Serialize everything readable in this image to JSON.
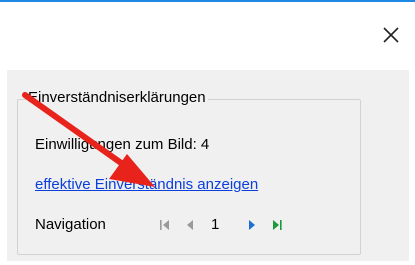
{
  "dialog": {
    "close_icon": "close-icon",
    "accent_color": "#1e88e5"
  },
  "group": {
    "title": "Einverständniserklärungen"
  },
  "consents": {
    "label": "Einwilligungen zum Bild: 4"
  },
  "link": {
    "text": "effektive Einverständnis anzeigen",
    "color": "#0a3fdb"
  },
  "navigation": {
    "label": "Navigation",
    "current_page": "1",
    "icons": [
      "first-page-icon",
      "previous-page-icon",
      "next-page-icon",
      "last-page-icon"
    ],
    "inactive_color": "#9a9a9a",
    "next_color": "#1c6fd0",
    "last_color": "#1a9a3a"
  },
  "annotation": {
    "arrow_color": "#e8231b"
  }
}
